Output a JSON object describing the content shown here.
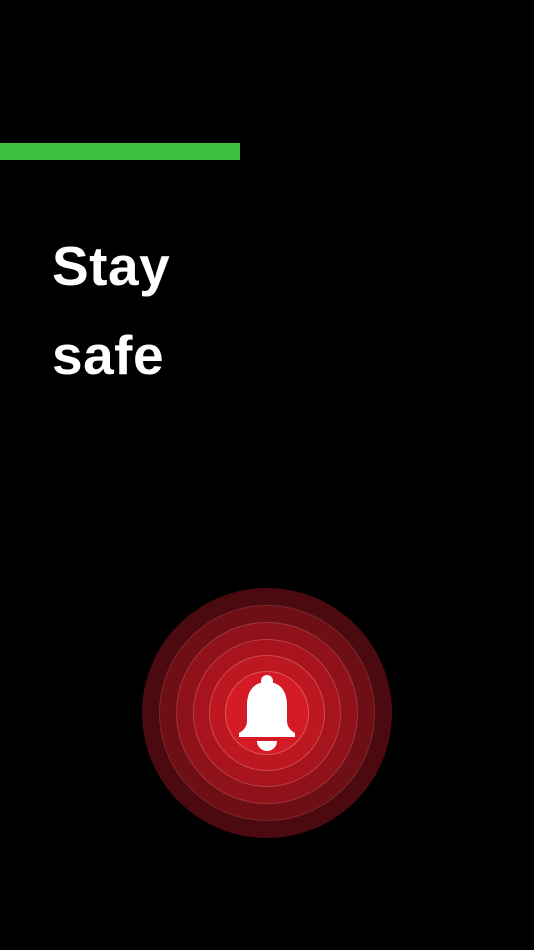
{
  "progress": {
    "fraction": 0.45,
    "color": "#3dbf3f"
  },
  "headline": {
    "line1": "Stay",
    "line2": "safe"
  },
  "alarm": {
    "icon": "bell-icon",
    "colors": {
      "core": "#d41a24",
      "outer": "#4a0a0f"
    }
  }
}
